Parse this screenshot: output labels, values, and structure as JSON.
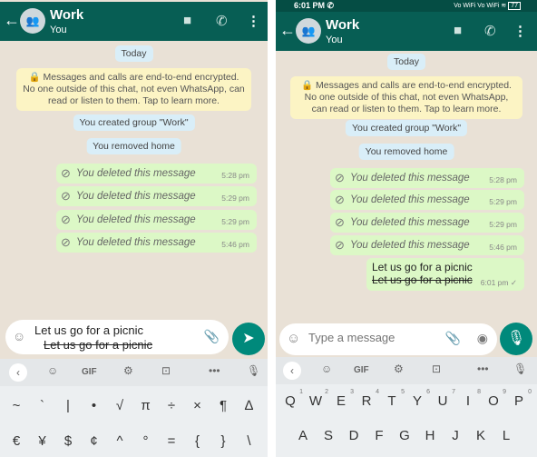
{
  "left": {
    "header": {
      "title": "Work",
      "subtitle": "You"
    },
    "date_label": "Today",
    "encryption_notice": "Messages and calls are end-to-end encrypted. No one outside of this chat, not even WhatsApp, can read or listen to them. Tap to learn more.",
    "system_messages": [
      "You created group \"Work\"",
      "You removed home"
    ],
    "deleted_messages": [
      {
        "text": "You deleted this message",
        "time": "5:28 pm"
      },
      {
        "text": "You deleted this message",
        "time": "5:29 pm"
      },
      {
        "text": "You deleted this message",
        "time": "5:29 pm"
      },
      {
        "text": "You deleted this message",
        "time": "5:46 pm"
      }
    ],
    "input": {
      "value": "Let us go for a picnic",
      "strikethrough_value": "Let us go for a picnic"
    },
    "keyboard": {
      "toolbar": {
        "gif": "GIF"
      },
      "row1": [
        "~",
        "`",
        "|",
        "•",
        "√",
        "π",
        "÷",
        "×",
        "¶",
        "∆"
      ],
      "row2": [
        "€",
        "¥",
        "$",
        "¢",
        "^",
        "°",
        "=",
        "{",
        "}",
        "\\"
      ]
    }
  },
  "right": {
    "status_bar": {
      "time": "6:01 PM",
      "indicators": "Vo WiFi  Vo WiFi",
      "battery": "77"
    },
    "header": {
      "title": "Work",
      "subtitle": "You"
    },
    "date_label": "Today",
    "encryption_notice": "Messages and calls are end-to-end encrypted. No one outside of this chat, not even WhatsApp, can read or listen to them. Tap to learn more.",
    "system_messages": [
      "You created group \"Work\"",
      "You removed home"
    ],
    "deleted_messages": [
      {
        "text": "You deleted this message",
        "time": "5:28 pm"
      },
      {
        "text": "You deleted this message",
        "time": "5:29 pm"
      },
      {
        "text": "You deleted this message",
        "time": "5:29 pm"
      },
      {
        "text": "You deleted this message",
        "time": "5:46 pm"
      }
    ],
    "sent_message": {
      "line1": "Let us go for a picnic",
      "line2": "Let us go for a picnic",
      "time": "6:01 pm",
      "status": "✓"
    },
    "input": {
      "placeholder": "Type a message"
    },
    "keyboard": {
      "toolbar": {
        "gif": "GIF"
      },
      "row1": [
        {
          "k": "Q",
          "n": "1"
        },
        {
          "k": "W",
          "n": "2"
        },
        {
          "k": "E",
          "n": "3"
        },
        {
          "k": "R",
          "n": "4"
        },
        {
          "k": "T",
          "n": "5"
        },
        {
          "k": "Y",
          "n": "6"
        },
        {
          "k": "U",
          "n": "7"
        },
        {
          "k": "I",
          "n": "8"
        },
        {
          "k": "O",
          "n": "9"
        },
        {
          "k": "P",
          "n": "0"
        }
      ],
      "row2": [
        "A",
        "S",
        "D",
        "F",
        "G",
        "H",
        "J",
        "K",
        "L"
      ]
    }
  },
  "colors": {
    "header": "#075e54",
    "bubble": "#dcf8c6",
    "send": "#00897b"
  }
}
